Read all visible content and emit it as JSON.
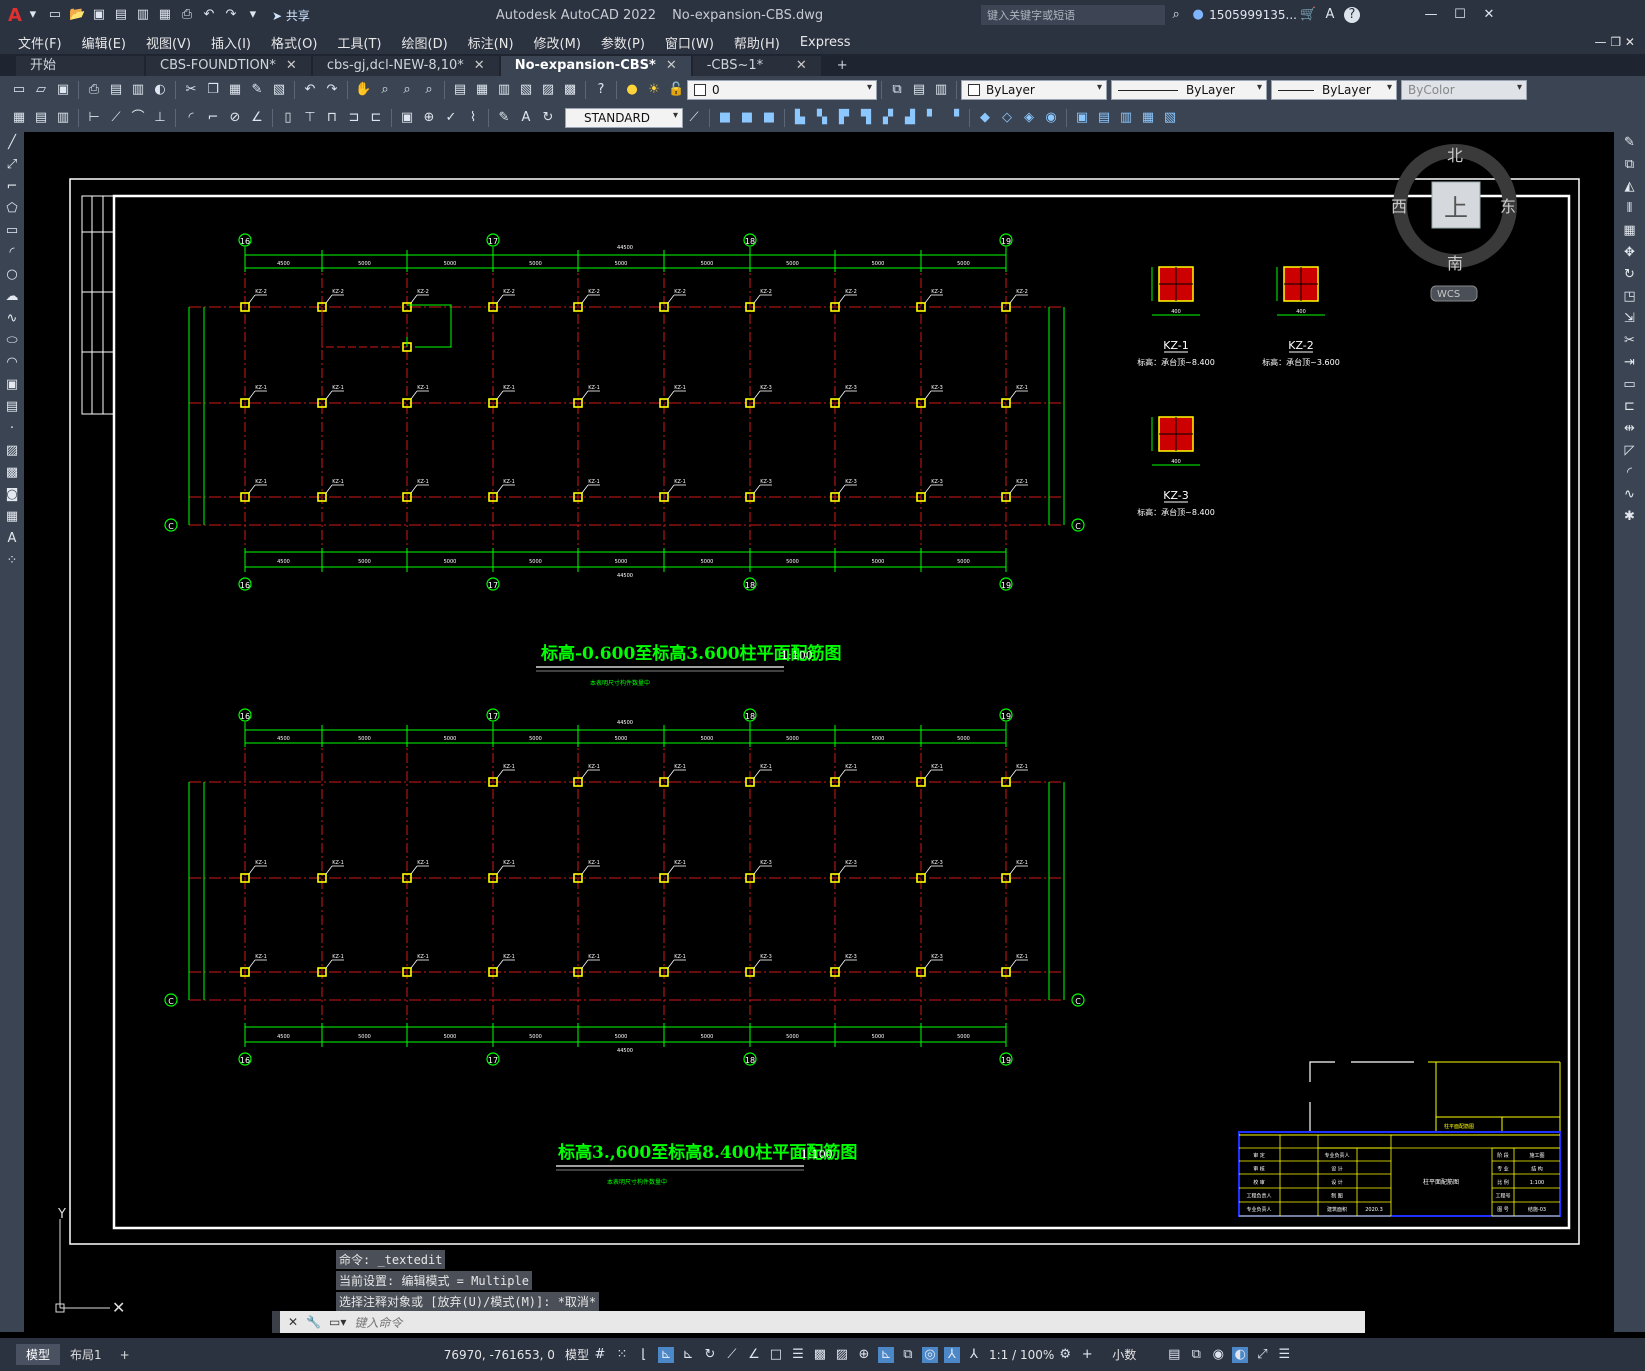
{
  "titlebar": {
    "app": "Autodesk AutoCAD 2022",
    "file": "No-expansion-CBS.dwg",
    "search_placeholder": "键入关键字或短语",
    "user": "1505999135...",
    "share": "共享"
  },
  "menu": [
    "文件(F)",
    "编辑(E)",
    "视图(V)",
    "插入(I)",
    "格式(O)",
    "工具(T)",
    "绘图(D)",
    "标注(N)",
    "修改(M)",
    "参数(P)",
    "窗口(W)",
    "帮助(H)",
    "Express"
  ],
  "tabs": [
    {
      "label": "开始",
      "close": false,
      "active": false
    },
    {
      "label": "CBS-FOUNDTION*",
      "close": true,
      "active": false
    },
    {
      "label": "cbs-gj,dcl-NEW-8,10*",
      "close": true,
      "active": false
    },
    {
      "label": "No-expansion-CBS*",
      "close": true,
      "active": true
    },
    {
      "label": "-CBS~1*",
      "close": true,
      "active": false
    }
  ],
  "toolbar": {
    "layer": "0",
    "color": "ByLayer",
    "linetype": "ByLayer",
    "lineweight": "ByLayer",
    "plotstyle": "ByColor",
    "textstyle": "STANDARD"
  },
  "viewcube": {
    "north": "北",
    "south": "南",
    "east": "东",
    "west": "西",
    "top": "上",
    "wcs": "WCS"
  },
  "drawing": {
    "axis_labels": [
      "16",
      "17",
      "18",
      "19"
    ],
    "row_label": "C",
    "plan1_title": "标高-0.600至标高3.600柱平面配筋图",
    "plan1_scale": "1:100",
    "plan2_title": "标高3.,600至标高8.400柱平面配筋图",
    "plan2_scale": "1:100",
    "note": "本表明尺寸构件数量中",
    "total_dim": "44500",
    "spans": [
      "4500",
      "5000",
      "5000",
      "5000",
      "5000",
      "5000",
      "5000",
      "5000",
      "5000"
    ],
    "column_tags": [
      "KZ-1",
      "KZ-2",
      "KZ-3"
    ],
    "details": [
      {
        "name": "KZ-1",
        "elev": "标高：承台顶~8.400",
        "size": "400"
      },
      {
        "name": "KZ-2",
        "elev": "标高：承台顶~3.600",
        "size": "400"
      },
      {
        "name": "KZ-3",
        "elev": "标高：承台顶~8.400",
        "size": "400"
      }
    ],
    "titleblock": {
      "project": "柱平面配筋图",
      "left": [
        "审 定",
        "审 核",
        "校 审",
        "工程负责人",
        "专业负责人"
      ],
      "mid": [
        "专业负责人",
        "设 计",
        "设 计",
        "制 图",
        "建筑面积"
      ],
      "right": [
        "阶 段",
        "专 业",
        "比 例",
        "工程号",
        "图 号"
      ],
      "right_vals": [
        "施工图",
        "结 构",
        "1:100",
        "",
        "结施-03"
      ],
      "date": "2020.3"
    }
  },
  "command": {
    "history": [
      "命令: _textedit",
      "当前设置: 编辑模式 = Multiple",
      "选择注释对象或 [放弃(U)/模式(M)]: *取消*"
    ],
    "placeholder": "键入命令"
  },
  "status": {
    "layout_tabs": [
      "模型",
      "布局1"
    ],
    "coords": "76970, -761653, 0",
    "model": "模型",
    "scale": "1:1 / 100%",
    "units": "小数"
  },
  "colors": {
    "green": "#00ff00",
    "red": "#d01818",
    "yellow": "#ffff00",
    "white": "#ffffff",
    "blue": "#2030ff"
  }
}
